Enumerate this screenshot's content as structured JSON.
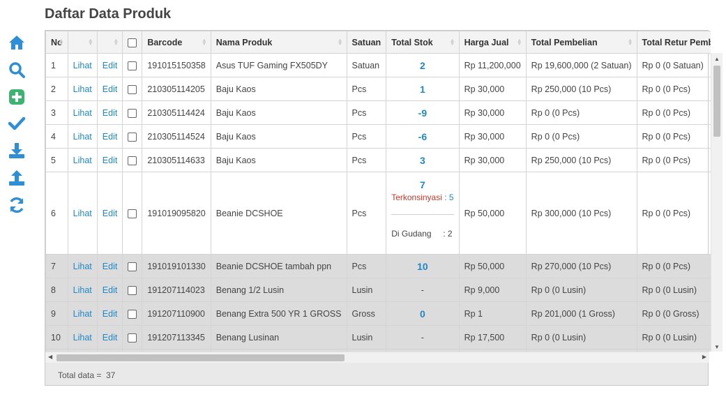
{
  "page": {
    "title": "Daftar Data Produk"
  },
  "sidebar": {
    "icons": [
      "home-icon",
      "search-icon",
      "add-icon",
      "check-icon",
      "download-icon",
      "upload-icon",
      "refresh-icon"
    ],
    "colors": {
      "primary": "#2f8fd6",
      "add": "#3cb371"
    }
  },
  "table": {
    "headers": {
      "no": "No",
      "view": "",
      "edit": "",
      "barcode": "Barcode",
      "name": "Nama Produk",
      "unit": "Satuan",
      "stock": "Total Stok",
      "price": "Harga Jual",
      "purchase": "Total Pembelian",
      "retur": "Total Retur Pembelian"
    },
    "view_label": "Lihat",
    "edit_label": "Edit",
    "rows": [
      {
        "no": "1",
        "barcode": "191015150358",
        "name": "Asus TUF Gaming FX505DY",
        "unit": "Satuan",
        "stock": "2",
        "price": "Rp 11,200,000",
        "purchase": "Rp 19,600,000 (2 Satuan)",
        "retur": "Rp 0 (0 Satuan)"
      },
      {
        "no": "2",
        "barcode": "210305114205",
        "name": "Baju Kaos",
        "unit": "Pcs",
        "stock": "1",
        "price": "Rp 30,000",
        "purchase": "Rp 250,000 (10 Pcs)",
        "retur": "Rp 0 (0 Pcs)"
      },
      {
        "no": "3",
        "barcode": "210305114424",
        "name": "Baju Kaos",
        "unit": "Pcs",
        "stock": "-9",
        "price": "Rp 30,000",
        "purchase": "Rp 0 (0 Pcs)",
        "retur": "Rp 0 (0 Pcs)"
      },
      {
        "no": "4",
        "barcode": "210305114524",
        "name": "Baju Kaos",
        "unit": "Pcs",
        "stock": "-6",
        "price": "Rp 30,000",
        "purchase": "Rp 0 (0 Pcs)",
        "retur": "Rp 0 (0 Pcs)"
      },
      {
        "no": "5",
        "barcode": "210305114633",
        "name": "Baju Kaos",
        "unit": "Pcs",
        "stock": "3",
        "price": "Rp 30,000",
        "purchase": "Rp 250,000 (10 Pcs)",
        "retur": "Rp 0 (0 Pcs)"
      },
      {
        "no": "6",
        "barcode": "191019095820",
        "name": "Beanie DCSHOE",
        "unit": "Pcs",
        "stock": "7",
        "stock_konsinyasi_label": "Terkonsinyasi",
        "stock_konsinyasi": ": 5",
        "stock_gudang_label": "Di Gudang",
        "stock_gudang": ": 2",
        "price": "Rp 50,000",
        "purchase": "Rp 300,000 (10 Pcs)",
        "retur": "Rp 0 (0 Pcs)"
      },
      {
        "no": "7",
        "barcode": "191019101330",
        "name": "Beanie DCSHOE tambah ppn",
        "unit": "Pcs",
        "stock": "10",
        "price": "Rp 50,000",
        "purchase": "Rp 270,000 (10 Pcs)",
        "retur": "Rp 0 (0 Pcs)"
      },
      {
        "no": "8",
        "barcode": "191207114023",
        "name": "Benang 1/2 Lusin",
        "unit": "Lusin",
        "stock": "-",
        "price": "Rp 9,000",
        "purchase": "Rp 0 (0 Lusin)",
        "retur": "Rp 0 (0 Lusin)"
      },
      {
        "no": "9",
        "barcode": "191207110900",
        "name": "Benang Extra 500 YR 1 GROSS",
        "unit": "Gross",
        "stock": "0",
        "price": "Rp 1",
        "purchase": "Rp 201,000 (1 Gross)",
        "retur": "Rp 0 (0 Gross)"
      },
      {
        "no": "10",
        "barcode": "191207113345",
        "name": "Benang Lusinan",
        "unit": "Lusin",
        "stock": "-",
        "price": "Rp 17,500",
        "purchase": "Rp 0 (0 Lusin)",
        "retur": "Rp 0 (0 Lusin)"
      }
    ]
  },
  "footer": {
    "total_label": "Total data =",
    "total_value": "37"
  }
}
